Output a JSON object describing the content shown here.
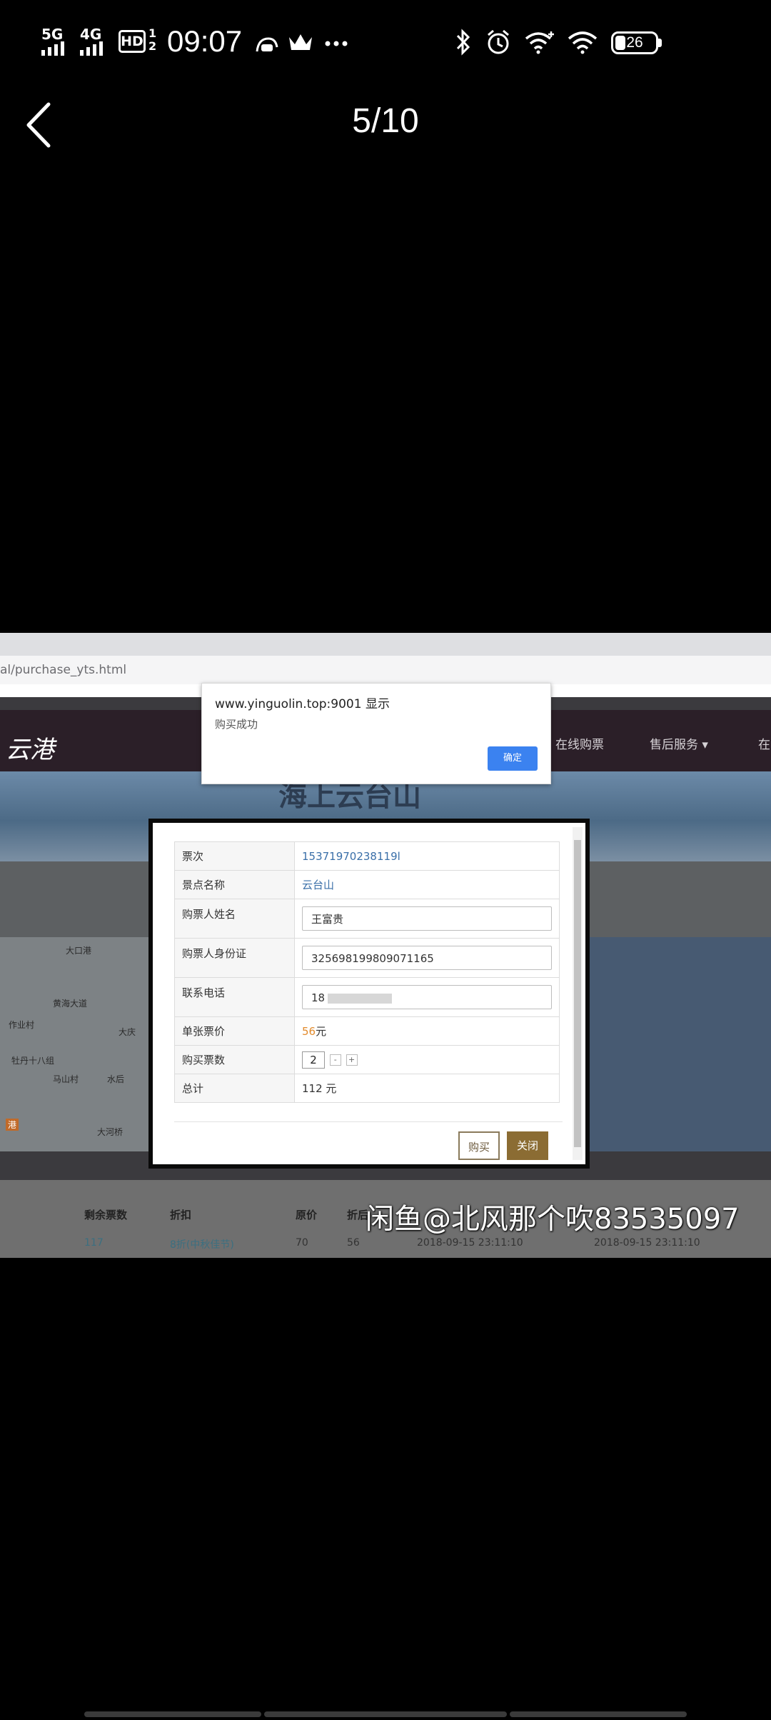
{
  "status_bar": {
    "network_1": "5G",
    "network_2": "4G",
    "hd_label": "HD",
    "hd_sub": "1\n2",
    "time": "09:07",
    "battery_level": "26",
    "icons": [
      "signal-icon",
      "hd-voice-icon",
      "android-cloud-icon",
      "crown-icon",
      "more-dots-icon",
      "bluetooth-icon",
      "alarm-icon",
      "wifi-plus-icon",
      "wifi-icon",
      "battery-icon"
    ]
  },
  "viewer": {
    "counter": "5/10"
  },
  "screenshot": {
    "url": "al/purchase_yts.html",
    "site_logo": "云港",
    "nav": [
      "在线购票",
      "售后服务 ▾",
      "在"
    ],
    "banner_title": "海上云台山",
    "alert": {
      "title": "www.yinguolin.top:9001 显示",
      "message": "购买成功",
      "ok_label": "确定"
    },
    "form": {
      "rows": [
        {
          "label": "票次",
          "value": "15371970238119l"
        },
        {
          "label": "景点名称",
          "value": "云台山"
        },
        {
          "label": "购票人姓名",
          "input": "王富贵"
        },
        {
          "label": "购票人身份证",
          "input": "325698199809071165"
        },
        {
          "label": "联系电话",
          "input": "18"
        },
        {
          "label": "单张票价",
          "price": "56",
          "unit": "元"
        },
        {
          "label": "购买票数",
          "quantity": "2",
          "minus": "-",
          "plus": "+"
        },
        {
          "label": "总计",
          "value": "112 元"
        }
      ],
      "buy_label": "购买",
      "close_label": "关闭"
    },
    "map_labels": [
      "大口港",
      "黄海大道",
      "作业村",
      "牡丹十八组",
      "马山村",
      "大庆",
      "水后",
      "大河桥",
      "港"
    ],
    "table_headers": [
      "剩余票数",
      "折扣",
      "原价",
      "折后"
    ],
    "table_row": [
      "117",
      "8折(中秋佳节)",
      "70",
      "56",
      "2018-09-15 23:11:10",
      "2018-09-15 23:11:10"
    ]
  },
  "watermark": "闲鱼@北风那个吹83535097"
}
